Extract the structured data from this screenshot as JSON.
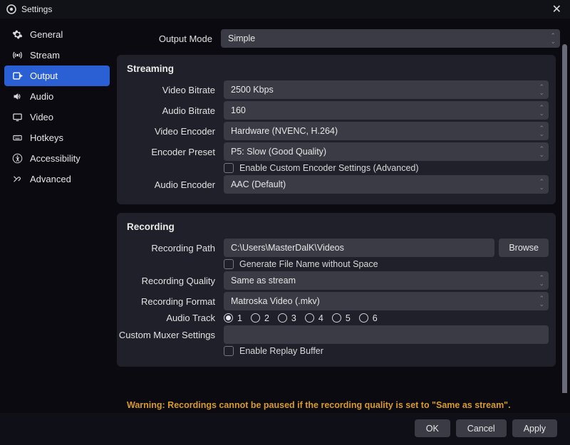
{
  "window": {
    "title": "Settings"
  },
  "sidebar": {
    "items": [
      {
        "label": "General"
      },
      {
        "label": "Stream"
      },
      {
        "label": "Output"
      },
      {
        "label": "Audio"
      },
      {
        "label": "Video"
      },
      {
        "label": "Hotkeys"
      },
      {
        "label": "Accessibility"
      },
      {
        "label": "Advanced"
      }
    ],
    "active_index": 2
  },
  "output_mode": {
    "label": "Output Mode",
    "value": "Simple"
  },
  "streaming": {
    "title": "Streaming",
    "video_bitrate": {
      "label": "Video Bitrate",
      "value": "2500 Kbps"
    },
    "audio_bitrate": {
      "label": "Audio Bitrate",
      "value": "160"
    },
    "video_encoder": {
      "label": "Video Encoder",
      "value": "Hardware (NVENC, H.264)"
    },
    "encoder_preset": {
      "label": "Encoder Preset",
      "value": "P5: Slow (Good Quality)"
    },
    "enable_custom": {
      "label": "Enable Custom Encoder Settings (Advanced)",
      "checked": false
    },
    "audio_encoder": {
      "label": "Audio Encoder",
      "value": "AAC (Default)"
    }
  },
  "recording": {
    "title": "Recording",
    "path": {
      "label": "Recording Path",
      "value": "C:\\Users\\MasterDalK\\Videos",
      "browse": "Browse"
    },
    "gen_no_space": {
      "label": "Generate File Name without Space",
      "checked": false
    },
    "quality": {
      "label": "Recording Quality",
      "value": "Same as stream"
    },
    "format": {
      "label": "Recording Format",
      "value": "Matroska Video (.mkv)"
    },
    "audio_track": {
      "label": "Audio Track",
      "options": [
        "1",
        "2",
        "3",
        "4",
        "5",
        "6"
      ],
      "selected_index": 0
    },
    "muxer": {
      "label": "Custom Muxer Settings",
      "value": ""
    },
    "replay_buffer": {
      "label": "Enable Replay Buffer",
      "checked": false
    }
  },
  "warning": "Warning: Recordings cannot be paused if the recording quality is set to \"Same as stream\".",
  "buttons": {
    "ok": "OK",
    "cancel": "Cancel",
    "apply": "Apply"
  }
}
